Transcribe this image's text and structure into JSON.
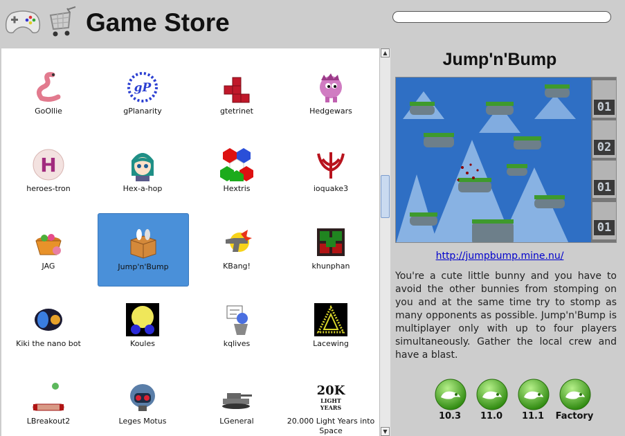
{
  "app": {
    "title": "Game Store"
  },
  "search": {
    "value": "",
    "placeholder": ""
  },
  "games": [
    {
      "label": "GoOllie",
      "icon": "worm-icon"
    },
    {
      "label": "gPlanarity",
      "icon": "gplanarity-icon"
    },
    {
      "label": "gtetrinet",
      "icon": "tetris-block-icon"
    },
    {
      "label": "Hedgewars",
      "icon": "hedgehog-icon"
    },
    {
      "label": "heroes-tron",
      "icon": "heroes-tron-icon"
    },
    {
      "label": "Hex-a-hop",
      "icon": "anime-girl-icon"
    },
    {
      "label": "Hextris",
      "icon": "hextris-icon"
    },
    {
      "label": "ioquake3",
      "icon": "quake-icon"
    },
    {
      "label": "JAG",
      "icon": "jag-basket-icon"
    },
    {
      "label": "Jump'n'Bump",
      "icon": "jumpnbump-box-icon"
    },
    {
      "label": "KBang!",
      "icon": "kbang-gun-icon"
    },
    {
      "label": "khunphan",
      "icon": "khunphan-icon"
    },
    {
      "label": "Kiki the nano bot",
      "icon": "kiki-icon"
    },
    {
      "label": "Koules",
      "icon": "koules-icon"
    },
    {
      "label": "kqlives",
      "icon": "kqlives-icon"
    },
    {
      "label": "Lacewing",
      "icon": "lacewing-icon"
    },
    {
      "label": "LBreakout2",
      "icon": "lbreakout-icon"
    },
    {
      "label": "Leges Motus",
      "icon": "helmet-icon"
    },
    {
      "label": "LGeneral",
      "icon": "tank-icon"
    },
    {
      "label": "20.000 Light Years into Space",
      "icon": "20k-light-years-icon"
    }
  ],
  "selected_index": 9,
  "detail": {
    "title": "Jump'n'Bump",
    "url": "http://jumpbump.mine.nu/",
    "description": "You're a cute little bunny and you have to avoid the other bunnies from stomping on you and at the same time try to stomp as many opponents as possible. Jump'n'Bump is multiplayer only with up to four players simultaneously. Gather the local crew and have a blast.",
    "scores": [
      "01",
      "02",
      "01",
      "01"
    ],
    "versions": [
      "10.3",
      "11.0",
      "11.1",
      "Factory"
    ]
  },
  "colors": {
    "selected_tile": "#4a90d9",
    "link": "#0000cc",
    "gecko_green": "#4dae1c"
  }
}
